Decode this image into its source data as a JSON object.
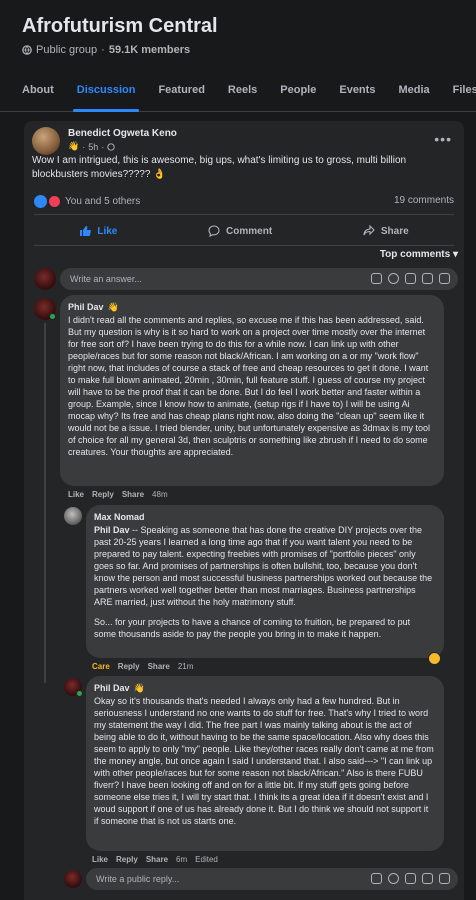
{
  "group": {
    "title": "Afrofuturism Central",
    "privacy": "Public group",
    "members": "59.1K members"
  },
  "tabs": [
    "About",
    "Discussion",
    "Featured",
    "Reels",
    "People",
    "Events",
    "Media",
    "Files"
  ],
  "post": {
    "author": "Benedict Ogweta Keno",
    "time": "5h",
    "text": "Wow I am intrigued, this is awesome, big ups, what's limiting us to gross, multi billion blockbusters movies????? 👌",
    "reactions": "You and 5 others",
    "comments_count": "19 comments",
    "like_label": "Like",
    "comment_label": "Comment",
    "share_label": "Share",
    "sort_label": "Top comments ▾"
  },
  "composer_top": {
    "placeholder": "Write an answer..."
  },
  "composer_bottom": {
    "placeholder": "Write a public reply..."
  },
  "comments": [
    {
      "name": "Phil Dav",
      "text": "I didn't read all the comments and replies, so excuse me if this has been addressed, said. But my question is why is it so hard to work on a project over time mostly over the internet for free sort of? I have been trying to do this for a while now. I can link up with other people/races but for some reason not black/African. I am working on a or my \"work flow\" right now, that includes of course a stack of free and cheap resources to get it done. I want to make full blown animated, 20min , 30min, full feature stuff. I guess of course my project will have to be the proof that it can be done. But I do feel I work better and faster within a group. Example, since I know how to animate, (setup rigs if I have to) I will be using Ai mocap why? Its free and has cheap plans right now, also doing the \"clean up\" seem like it would not be a issue. I tried blender, unity, but unfortunately expensive as 3dmax is my tool of choice for all my general 3d, then sculptris or something like zbrush if I need to do some creatures. Your thoughts are appreciated.",
      "like": "Like",
      "reply": "Reply",
      "share": "Share",
      "time": "48m"
    },
    {
      "name": "Max Nomad",
      "mention": "Phil Dav",
      "text": " -- Speaking as someone that has done the creative DIY projects over the past 20-25 years I learned a long time ago that if you want talent you need to be prepared to pay talent. expecting freebies with promises of \"portfolio pieces\" only goes so far. And promises of partnerships is often bullshit, too, because you don't know the person and most successful business partnerships worked out because the partners worked well together better than most marriages. Business partnerships ARE married, just without the holy matrimony stuff.",
      "text2": "So... for your projects to have a chance of coming to fruition, be prepared to put some thousands aside to pay the people you bring in to make it happen.",
      "care": "Care",
      "reply": "Reply",
      "share": "Share",
      "time": "21m"
    },
    {
      "name": "Phil Dav",
      "text": "Okay so it's thousands that's needed I always only had a few hundred. But in seriousness I understand no one wants to do stuff for free. That's why I tried to word my statement the way I did. The free part I was mainly talking about is the act of being able to do it, without having to be the same space/location. Also why does this seem to apply to only \"my\" people. Like they/other races really don't came at me from the money angle, but once again I said I understand that. I also said---> \"I can link up with other people/races but for some reason not black/African.\" Also is there FUBU fiverr? I have been looking off and on for a little bit. If my stuff gets going before someone else tries it, I will try start that. I think its a great idea if it doesn't exist and I woud support if one of us has already done it. But I do think we should not support it if someone that is not us starts one.",
      "like": "Like",
      "reply": "Reply",
      "share": "Share",
      "time": "6m",
      "edited": "Edited"
    }
  ],
  "colors": {
    "accent": "#2d88ff",
    "surface": "#242526",
    "bubble": "#3a3b3c",
    "care": "#f7b928"
  }
}
